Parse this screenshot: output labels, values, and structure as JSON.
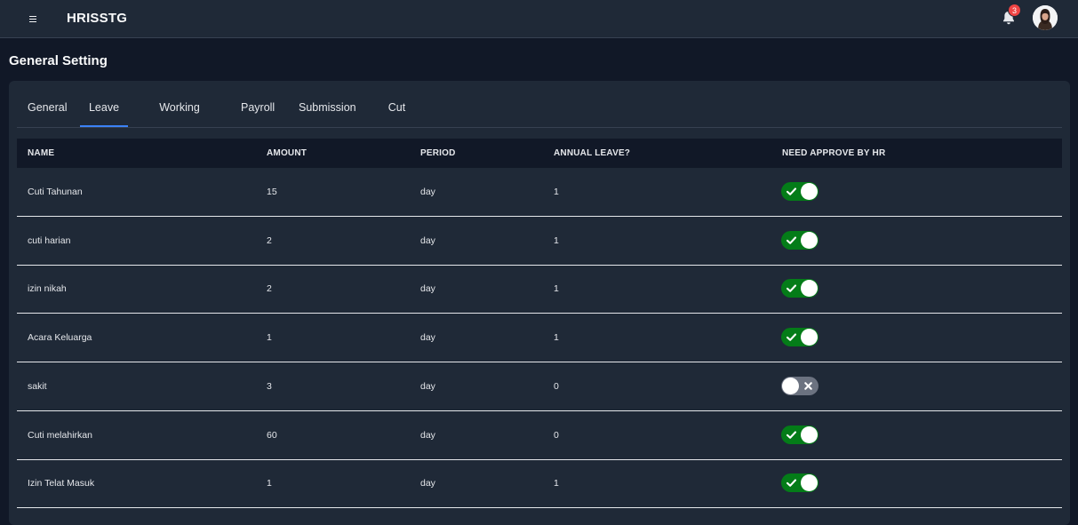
{
  "header": {
    "app_title": "HRISSTG",
    "notification_count": "3"
  },
  "page": {
    "title": "General Setting"
  },
  "tabs": [
    {
      "label": "General",
      "active": false
    },
    {
      "label": "Leave",
      "active": true
    },
    {
      "label": "Working Hours",
      "active": false
    },
    {
      "label": "Payroll",
      "active": false
    },
    {
      "label": "Submission",
      "active": false
    },
    {
      "label": "Cut Off",
      "active": false
    }
  ],
  "table": {
    "columns": {
      "name": "NAME",
      "amount": "AMOUNT",
      "period": "PERIOD",
      "annual_leave": "ANNUAL LEAVE?",
      "need_approve": "NEED APPROVE BY HR"
    },
    "rows": [
      {
        "name": "Cuti Tahunan",
        "amount": "15",
        "period": "day",
        "annual_leave": "1",
        "need_approve": true
      },
      {
        "name": "cuti harian",
        "amount": "2",
        "period": "day",
        "annual_leave": "1",
        "need_approve": true
      },
      {
        "name": "izin nikah",
        "amount": "2",
        "period": "day",
        "annual_leave": "1",
        "need_approve": true
      },
      {
        "name": "Acara Keluarga",
        "amount": "1",
        "period": "day",
        "annual_leave": "1",
        "need_approve": true
      },
      {
        "name": "sakit",
        "amount": "3",
        "period": "day",
        "annual_leave": "0",
        "need_approve": false
      },
      {
        "name": "Cuti melahirkan",
        "amount": "60",
        "period": "day",
        "annual_leave": "0",
        "need_approve": true
      },
      {
        "name": "Izin Telat Masuk",
        "amount": "1",
        "period": "day",
        "annual_leave": "1",
        "need_approve": true
      }
    ]
  },
  "icons": {
    "menu": "hamburger-menu-icon",
    "notifications": "bell-icon",
    "avatar": "user-avatar",
    "toggle_on": "check-icon",
    "toggle_off": "close-icon"
  },
  "colors": {
    "toggle_on": "#047c18",
    "toggle_off": "#6b7280",
    "active_tab": "#3b82f6",
    "badge": "#ef4444"
  }
}
